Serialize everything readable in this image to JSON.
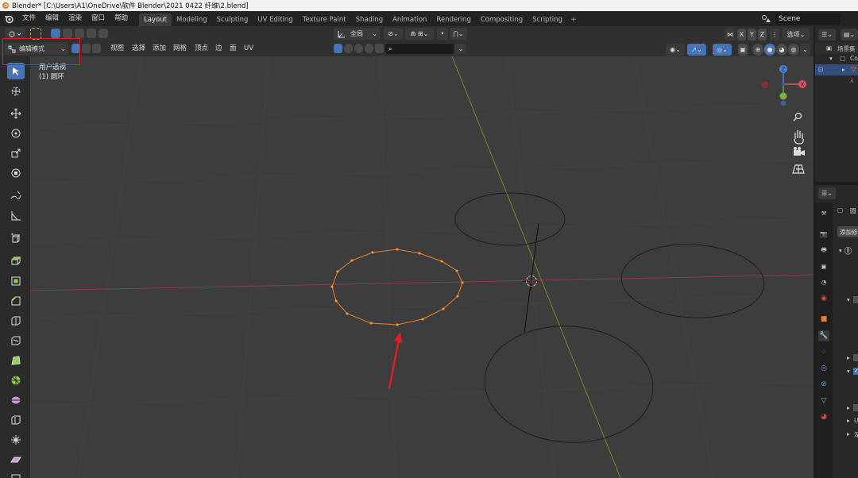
{
  "window": {
    "title": "Blender* [C:\\Users\\A1\\OneDrive\\软件 Blender\\2021 0422 纤维\\2.blend]"
  },
  "menu": {
    "items": [
      "文件",
      "编辑",
      "渲染",
      "窗口",
      "帮助"
    ]
  },
  "workspaces": {
    "tabs": [
      "Layout",
      "Modeling",
      "Sculpting",
      "UV Editing",
      "Texture Paint",
      "Shading",
      "Animation",
      "Rendering",
      "Compositing",
      "Scripting"
    ],
    "active": "Layout",
    "add": "+"
  },
  "scene": {
    "label": "Scene"
  },
  "header": {
    "transform_orientation": "全局",
    "snap_axes": [
      "X",
      "Y",
      "Z"
    ],
    "options_label": "选项",
    "mode_label": "编辑模式",
    "mesh_menus": [
      "视图",
      "选择",
      "添加",
      "网格",
      "顶点",
      "边",
      "面",
      "UV"
    ],
    "search_placeholder": ""
  },
  "viewport": {
    "perspective_label": "用户透视",
    "object_label": "(1) 圆环",
    "gizmo": {
      "x": "X",
      "y": "Y",
      "z": "Z"
    }
  },
  "outliner": {
    "title": "场景集",
    "row": "Co"
  },
  "properties": {
    "item1": "圆",
    "add_modifier": "添加修",
    "row_u": "U",
    "row_shen": "深"
  },
  "colors": {
    "accent": "#4772b3",
    "selected_mesh": "#e8822a",
    "x_axis": "#b3474f",
    "y_axis": "#8ba734",
    "annotation_red": "#e02020"
  }
}
